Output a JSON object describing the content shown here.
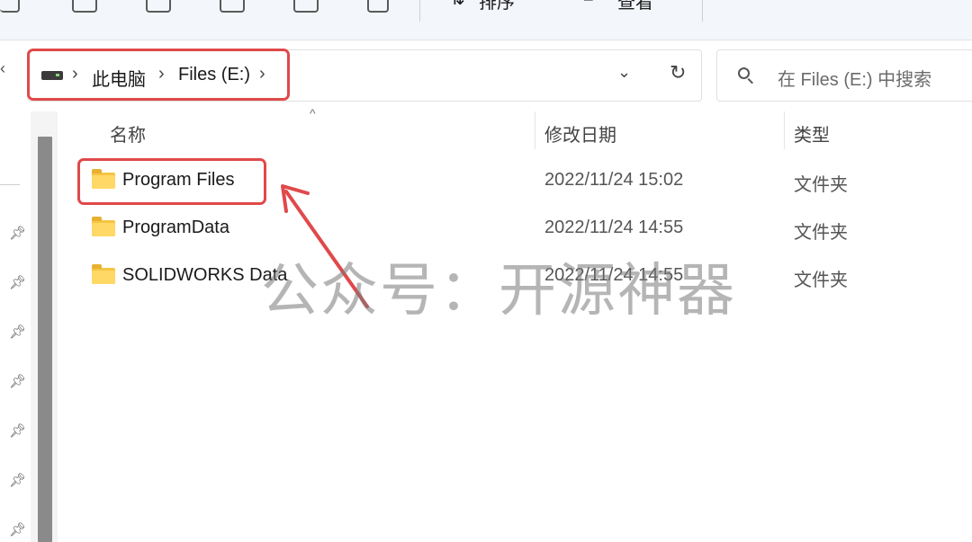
{
  "toolbar": {
    "sort_label": "排序",
    "view_label": "查看"
  },
  "address": {
    "crumbs": [
      "此电脑",
      "Files (E:)"
    ],
    "search_placeholder": "在 Files (E:) 中搜索"
  },
  "columns": {
    "name": "名称",
    "modified": "修改日期",
    "type": "类型"
  },
  "files": [
    {
      "name": "Program Files",
      "modified": "2022/11/24 15:02",
      "type": "文件夹"
    },
    {
      "name": "ProgramData",
      "modified": "2022/11/24 14:55",
      "type": "文件夹"
    },
    {
      "name": "SOLIDWORKS Data",
      "modified": "2022/11/24 14:55",
      "type": "文件夹"
    }
  ],
  "watermark": "公众号：开源神器",
  "colors": {
    "highlight": "#e0494a",
    "folder": "#ffd865",
    "accent": "#f3f6fb"
  },
  "icons": [
    "copy-icon",
    "paste-icon",
    "share-icon",
    "rename-icon",
    "delete-icon",
    "sort-icon",
    "view-icon",
    "drive-icon",
    "refresh-icon",
    "search-icon",
    "pin-icon",
    "folder-icon"
  ]
}
